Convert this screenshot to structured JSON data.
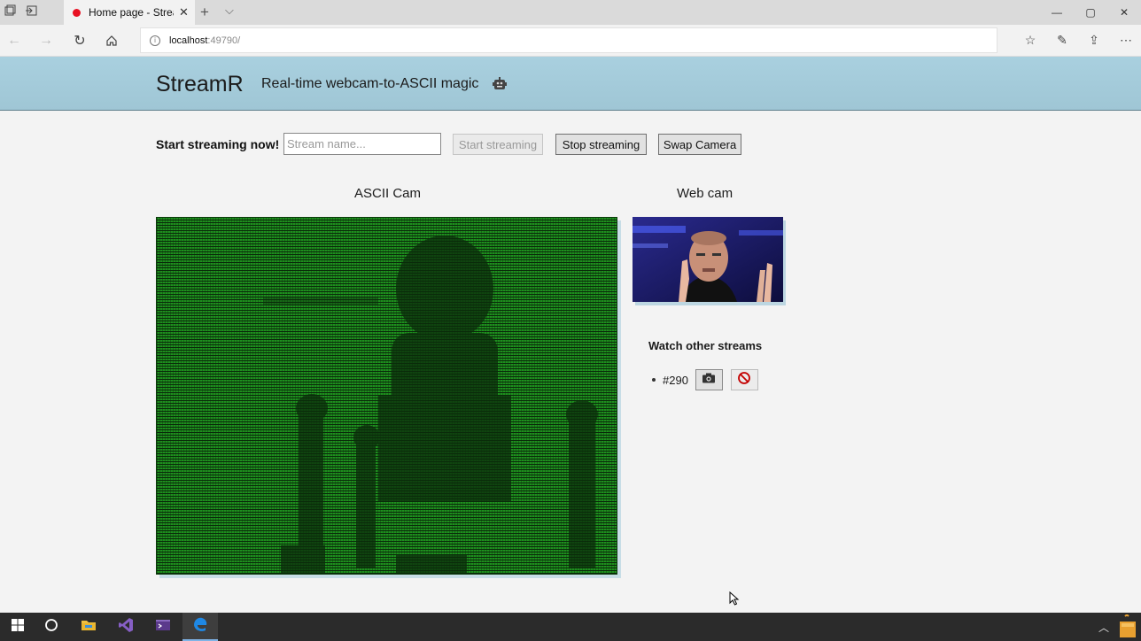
{
  "browser": {
    "tab_title": "Home page - Strea",
    "url_host": "localhost",
    "url_port": ":49790/"
  },
  "header": {
    "brand": "StreamR",
    "tagline": "Real-time webcam-to-ASCII magic"
  },
  "controls": {
    "start_label": "Start streaming now!",
    "stream_name_placeholder": "Stream name...",
    "start_button": "Start streaming",
    "stop_button": "Stop streaming",
    "swap_button": "Swap Camera"
  },
  "ascii_cam": {
    "title": "ASCII Cam"
  },
  "webcam": {
    "title": "Web cam"
  },
  "other_streams": {
    "title": "Watch other streams",
    "items": [
      {
        "id": "#290"
      }
    ]
  },
  "colors": {
    "header_bg": "#a9d0df",
    "ascii_green": "#1e8f1e",
    "accent_blue": "#0078d7"
  }
}
